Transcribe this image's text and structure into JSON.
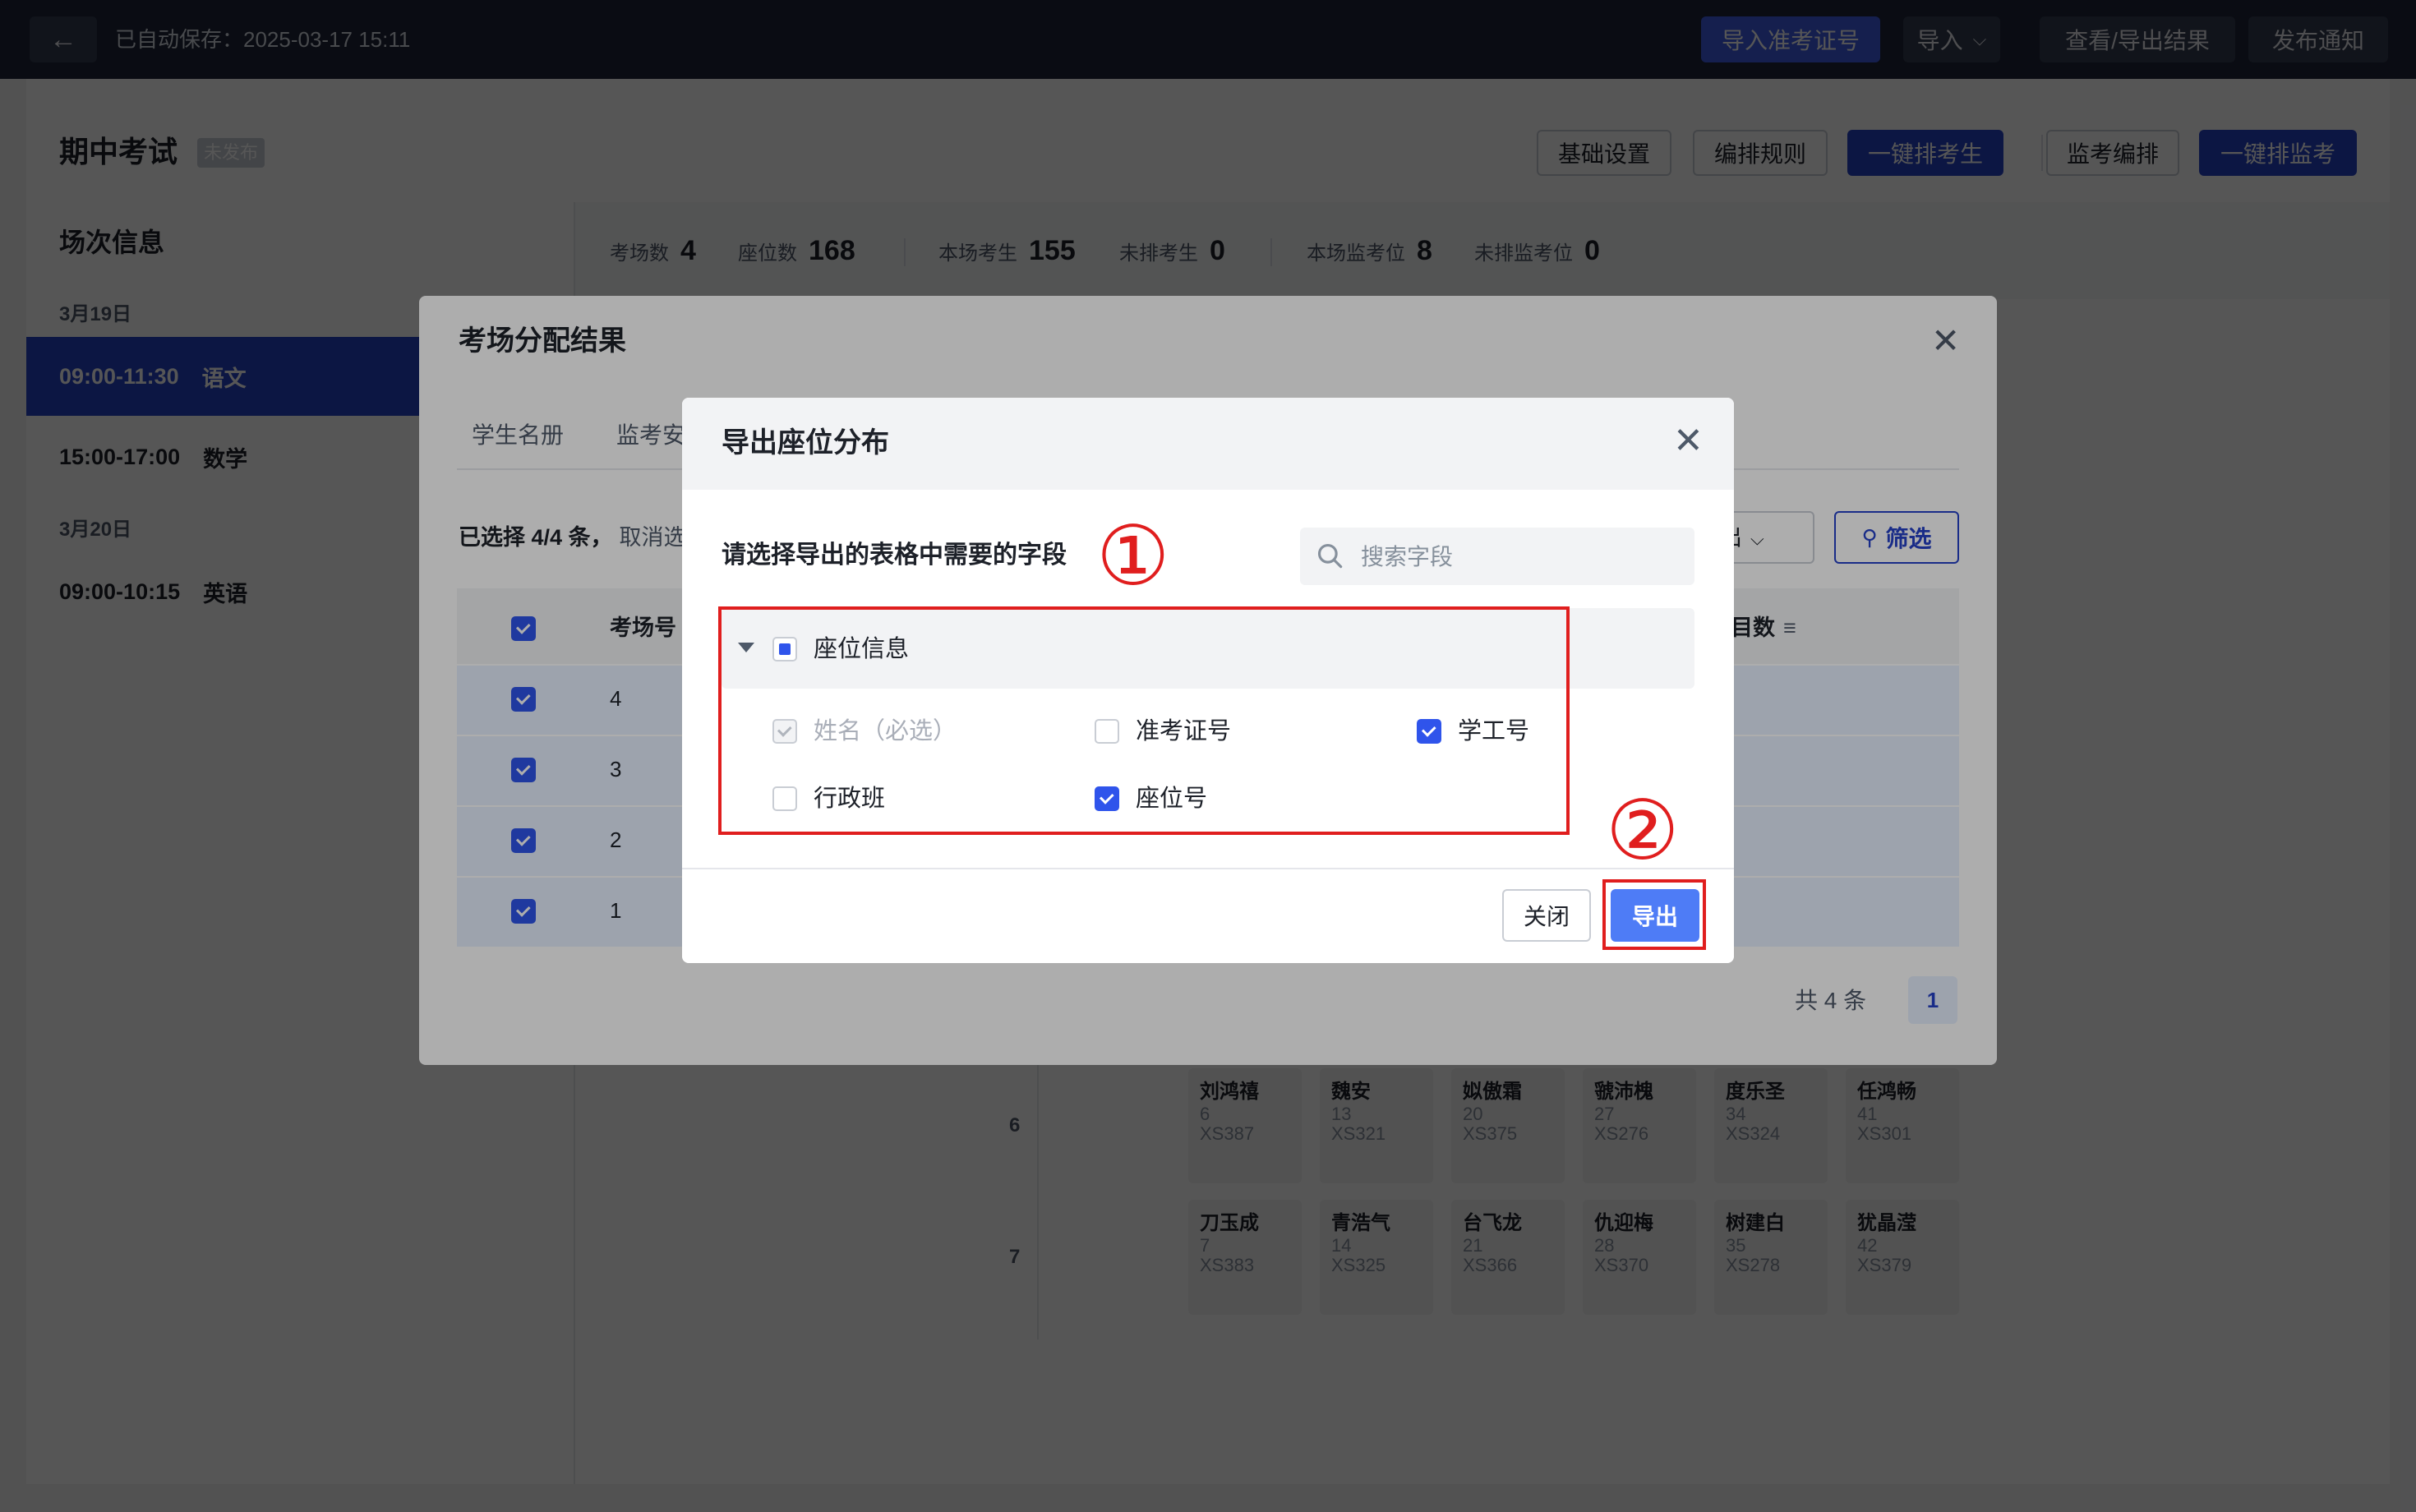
{
  "topbar": {
    "autosave": "已自动保存：2025-03-17 15:11",
    "buttons": [
      "导入准考证号",
      "导入",
      "查看/导出结果",
      "发布通知"
    ]
  },
  "exam": {
    "title": "期中考试",
    "status": "未发布",
    "actions": [
      "基础设置",
      "编排规则",
      "一键排考生",
      "监考编排",
      "一键排监考"
    ]
  },
  "sidebar": {
    "title": "场次信息",
    "groups": [
      {
        "date": "3月19日",
        "items": [
          {
            "time": "09:00-11:30",
            "subject": "语文"
          },
          {
            "time": "15:00-17:00",
            "subject": "数学"
          }
        ]
      },
      {
        "date": "3月20日",
        "items": [
          {
            "time": "09:00-10:15",
            "subject": "英语"
          }
        ]
      }
    ]
  },
  "stats": [
    {
      "label": "考场数",
      "value": "4"
    },
    {
      "label": "座位数",
      "value": "168"
    },
    {
      "label": "本场考生",
      "value": "155"
    },
    {
      "label": "未排考生",
      "value": "0"
    },
    {
      "label": "本场监考位",
      "value": "8"
    },
    {
      "label": "未排监考位",
      "value": "0"
    }
  ],
  "seats": {
    "rows": [
      {
        "num": "6",
        "seats": [
          {
            "name": "刘鸿禧",
            "no": "6",
            "id": "XS387"
          },
          {
            "name": "魏安",
            "no": "13",
            "id": "XS321"
          },
          {
            "name": "姒傲霜",
            "no": "20",
            "id": "XS375"
          },
          {
            "name": "虢沛槐",
            "no": "27",
            "id": "XS276"
          },
          {
            "name": "度乐圣",
            "no": "34",
            "id": "XS324"
          },
          {
            "name": "任鸿畅",
            "no": "41",
            "id": "XS301"
          }
        ]
      },
      {
        "num": "7",
        "seats": [
          {
            "name": "刀玉成",
            "no": "7",
            "id": "XS383"
          },
          {
            "name": "青浩气",
            "no": "14",
            "id": "XS325"
          },
          {
            "name": "台飞龙",
            "no": "21",
            "id": "XS366"
          },
          {
            "name": "仇迎梅",
            "no": "28",
            "id": "XS370"
          },
          {
            "name": "树建白",
            "no": "35",
            "id": "XS278"
          },
          {
            "name": "犹晶滢",
            "no": "42",
            "id": "XS379"
          }
        ]
      }
    ]
  },
  "result_dialog": {
    "title": "考场分配结果",
    "close": "✕",
    "tabs": [
      "学生名册",
      "监考安"
    ],
    "selected": "已选择 4/4 条，",
    "cancel_select": "取消选",
    "export_dropdown": "出",
    "filter": "筛选",
    "table": {
      "col_room": "考场号",
      "col_count": "目数",
      "rows": [
        "4",
        "3",
        "2",
        "1"
      ]
    },
    "total": "共 4 条",
    "page": "1"
  },
  "export_dialog": {
    "title": "导出座位分布",
    "close": "✕",
    "subtitle": "请选择导出的表格中需要的字段",
    "search_placeholder": "搜索字段",
    "group": "座位信息",
    "fields": [
      {
        "label": "姓名（必选）",
        "state": "disabled"
      },
      {
        "label": "准考证号",
        "state": "off"
      },
      {
        "label": "学工号",
        "state": "on"
      },
      {
        "label": "行政班",
        "state": "off"
      },
      {
        "label": "座位号",
        "state": "on"
      }
    ],
    "close_btn": "关闭",
    "export_btn": "导出"
  },
  "annotations": {
    "one": "①",
    "two": "②",
    "color": "#e01e1e"
  },
  "colors": {
    "primary": "#2642c9",
    "accent": "#4e7cf6",
    "topbar": "#1e2538"
  }
}
